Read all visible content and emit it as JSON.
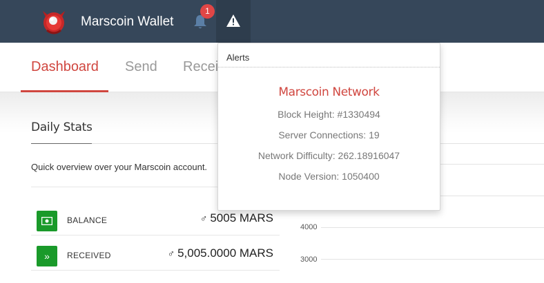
{
  "navbar": {
    "brand": "Marscoin Wallet",
    "logo_icon": "mars-logo-icon",
    "notifications": {
      "icon": "bell-icon",
      "badge": "1"
    },
    "alerts_icon": "warning-triangle-icon"
  },
  "tabs": [
    {
      "label": "Dashboard",
      "active": true
    },
    {
      "label": "Send",
      "active": false
    },
    {
      "label": "Receive",
      "active": false
    }
  ],
  "daily_stats": {
    "title": "Daily Stats",
    "description": "Quick overview over your Marscoin account.",
    "rows": [
      {
        "icon": "money-icon",
        "label": "BALANCE",
        "symbol": "♂",
        "value": "5005 MARS"
      },
      {
        "icon": "double-chevron-right-icon",
        "label": "RECEIVED",
        "symbol": "♂",
        "value": "5,005.0000 MARS"
      }
    ]
  },
  "chart": {
    "ticks": [
      "4000",
      "3000"
    ]
  },
  "alerts_dropdown": {
    "header": "Alerts",
    "title": "Marscoin Network",
    "lines": [
      "Block Height: #1330494",
      "Server Connections: 19",
      "Network Difficulty: 262.18916047",
      "Node Version: 1050400"
    ]
  },
  "colors": {
    "navbar": "#36475a",
    "accent": "#d0463f",
    "stat_icon": "#1a9a2a",
    "badge": "#e04646"
  }
}
